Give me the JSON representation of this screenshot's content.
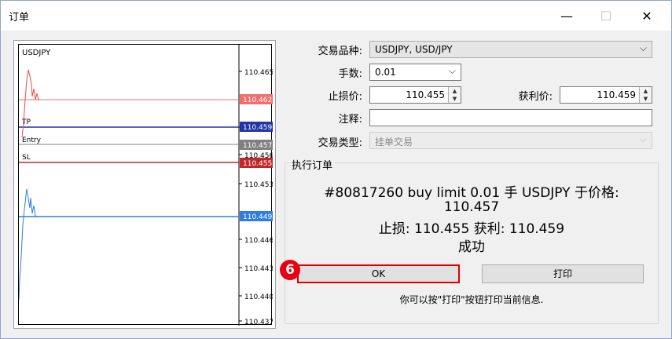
{
  "window": {
    "title": "订单",
    "minimize": "—",
    "maximize": "☐",
    "close": "✕"
  },
  "chart": {
    "symbol": "USDJPY",
    "price_axis": [
      "110.465",
      "110.459",
      "110.456",
      "110.453",
      "110.449",
      "110.446",
      "110.443",
      "110.440",
      "110.437"
    ],
    "levels": [
      {
        "name": "TP",
        "price": "110.459",
        "color": "#2234a8"
      },
      {
        "name": "Entry",
        "price": "110.457",
        "color": "#808080"
      },
      {
        "name": "SL",
        "price": "110.455",
        "color": "#c0282a"
      },
      {
        "name": "",
        "price": "110.462",
        "color": "#ef6f6c"
      },
      {
        "name": "",
        "price": "110.449",
        "color": "#2f7de1"
      }
    ]
  },
  "form": {
    "symbol_label": "交易品种:",
    "symbol_value": "USDJPY, USD/JPY",
    "volume_label": "手数:",
    "volume_value": "0.01",
    "sl_label": "止损价:",
    "sl_value": "110.455",
    "tp_label": "获利价:",
    "tp_value": "110.459",
    "comment_label": "注释:",
    "comment_value": "",
    "type_label": "交易类型:",
    "type_value": "挂单交易"
  },
  "result": {
    "group_title": "执行订单",
    "line1": "#80817260 buy limit 0.01 手 USDJPY 于价格:",
    "line2": "110.457",
    "line3": "止损: 110.455 获利: 110.459",
    "line4": "成功",
    "ok_label": "OK",
    "print_label": "打印",
    "hint": "你可以按\"打印\"按钮打印当前信息."
  },
  "annotation": {
    "step": "6"
  }
}
